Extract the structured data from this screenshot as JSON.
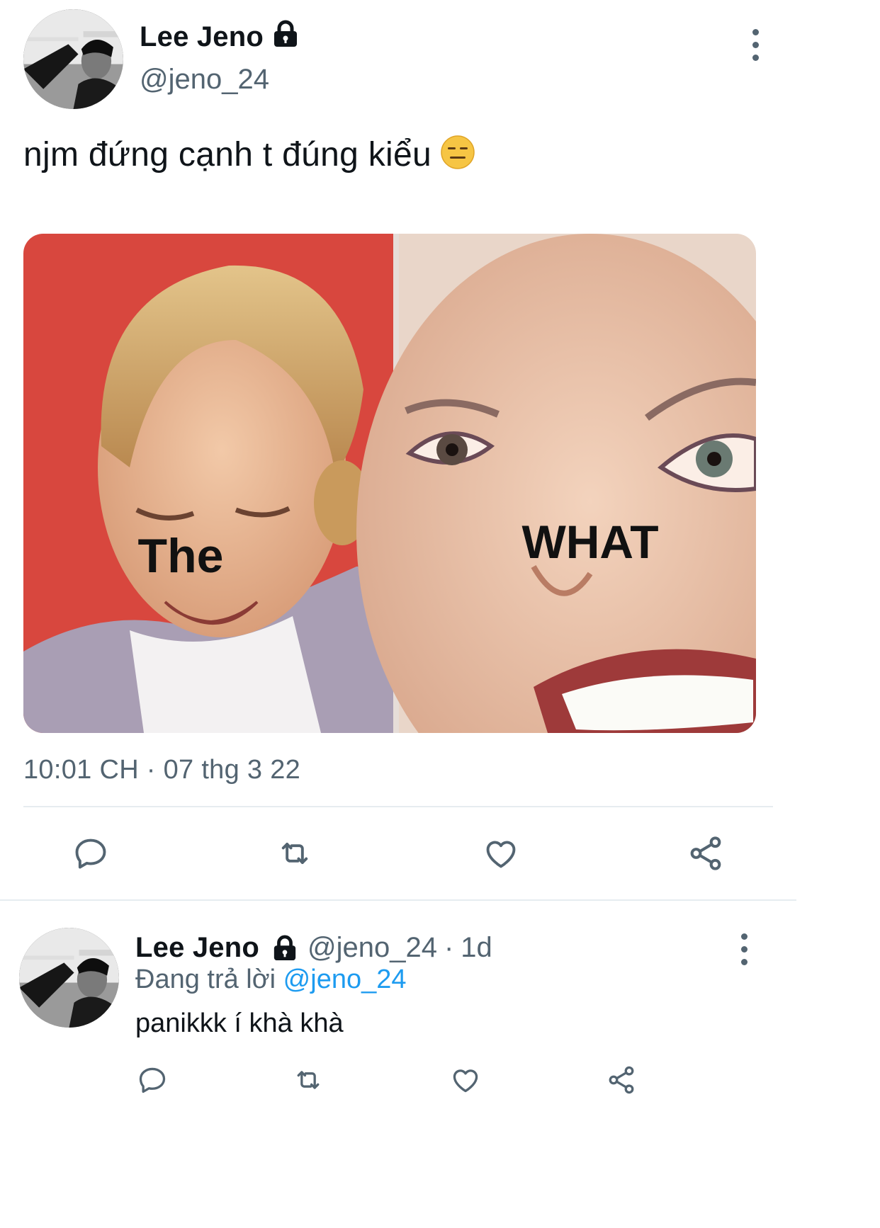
{
  "tweet": {
    "author_name": "Lee Jeno",
    "author_handle": "@jeno_24",
    "text": "njm đứng cạnh t đúng kiểu",
    "emoji": "expressionless-face",
    "media": {
      "left_caption": "The",
      "right_caption": "WHAT"
    },
    "timestamp": "10:01 CH · 07 thg 3 22",
    "actions": [
      "reply-icon",
      "retweet-icon",
      "like-icon",
      "share-icon"
    ]
  },
  "reply": {
    "author_name": "Lee Jeno",
    "author_handle": "@jeno_24",
    "separator": "·",
    "age": "1d",
    "replying_prefix": "Đang trả lời",
    "replying_to": "@jeno_24",
    "text": "panikkk í khà khà",
    "actions": [
      "reply-icon",
      "retweet-icon",
      "like-icon",
      "share-icon"
    ]
  },
  "colors": {
    "accent": "#1d9bf0",
    "secondary_text": "#536471",
    "meme_red": "#d8473e"
  }
}
